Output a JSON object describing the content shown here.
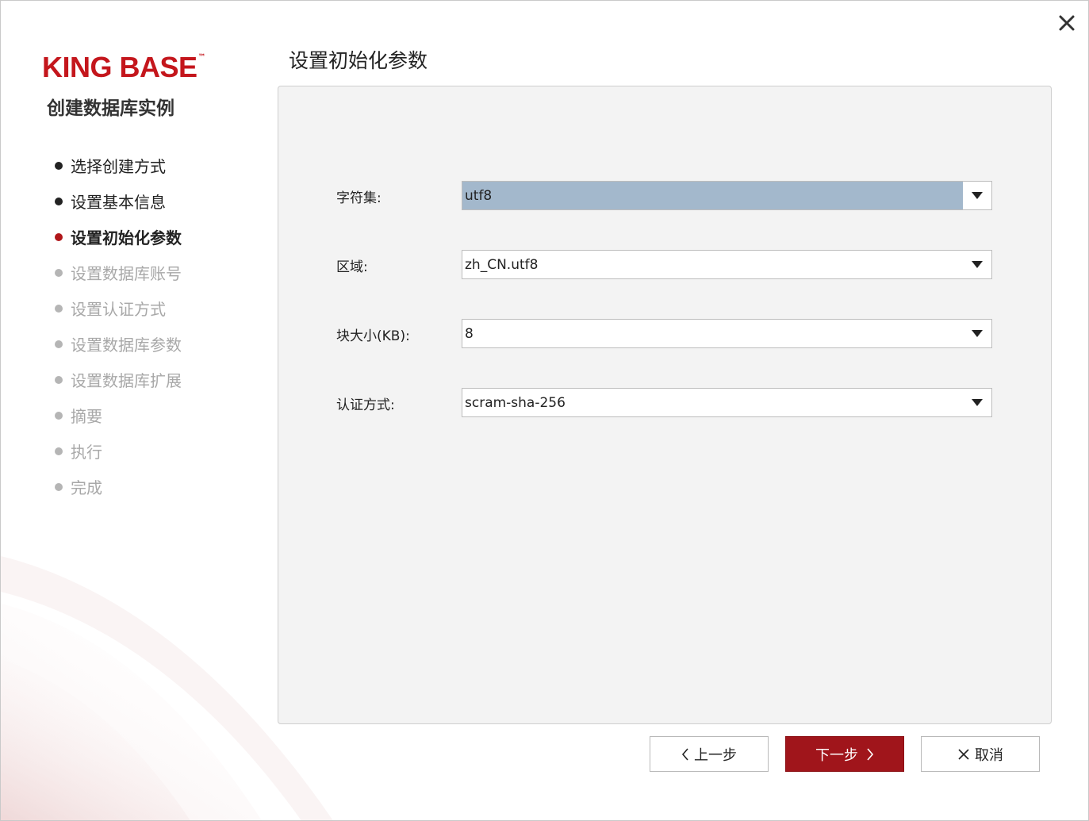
{
  "brand": {
    "logo_text": "KING BASE",
    "logo_tm": "™",
    "accent_color": "#c4161c"
  },
  "wizard": {
    "title": "创建数据库实例",
    "steps": [
      {
        "label": "选择创建方式",
        "state": "done"
      },
      {
        "label": "设置基本信息",
        "state": "done"
      },
      {
        "label": "设置初始化参数",
        "state": "active"
      },
      {
        "label": "设置数据库账号",
        "state": "todo"
      },
      {
        "label": "设置认证方式",
        "state": "todo"
      },
      {
        "label": "设置数据库参数",
        "state": "todo"
      },
      {
        "label": "设置数据库扩展",
        "state": "todo"
      },
      {
        "label": "摘要",
        "state": "todo"
      },
      {
        "label": "执行",
        "state": "todo"
      },
      {
        "label": "完成",
        "state": "todo"
      }
    ]
  },
  "page": {
    "title": "设置初始化参数"
  },
  "form": {
    "charset": {
      "label": "字符集:",
      "value": "utf8"
    },
    "locale": {
      "label": "区域:",
      "value": "zh_CN.utf8"
    },
    "block_size": {
      "label": "块大小(KB):",
      "value": "8"
    },
    "auth_method": {
      "label": "认证方式:",
      "value": "scram-sha-256"
    }
  },
  "buttons": {
    "prev": "上一步",
    "next": "下一步",
    "cancel": "取消"
  },
  "icons": {
    "close": "close-icon",
    "dropdown": "chevron-down-icon",
    "prev": "chevron-left-icon",
    "next": "chevron-right-icon",
    "cancel": "x-icon"
  },
  "colors": {
    "primary_button": "#a0151b",
    "focused_field": "#a3b8cc",
    "panel_bg": "#f3f3f3"
  }
}
